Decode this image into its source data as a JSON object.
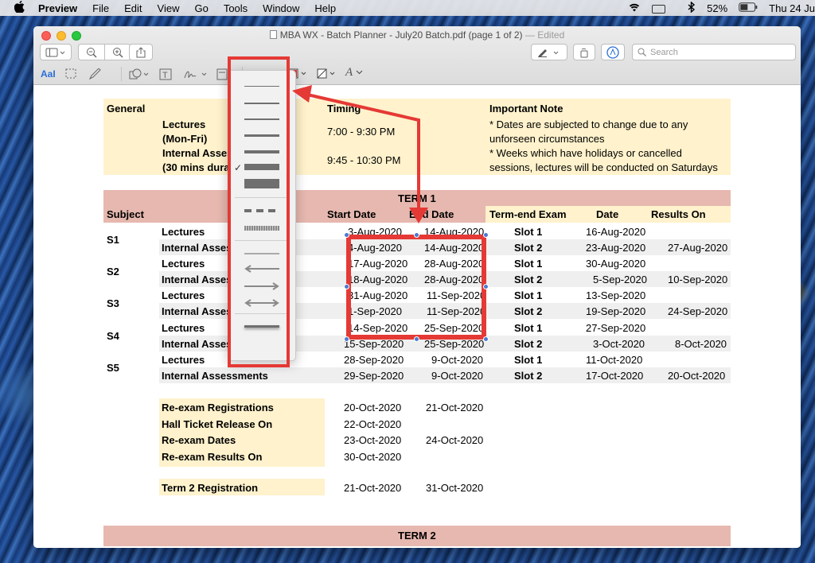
{
  "menubar": {
    "apple": "",
    "app": "Preview",
    "items": [
      "File",
      "Edit",
      "View",
      "Go",
      "Tools",
      "Window",
      "Help"
    ],
    "battery": "52%",
    "clock": "Thu 24 Ju"
  },
  "window": {
    "title": "MBA WX - Batch Planner - July20 Batch.pdf (page 1 of 2)",
    "edited": "— Edited",
    "search_placeholder": "Search"
  },
  "markup_toolbar": {
    "text_style": "AaI",
    "font_tool": "A"
  },
  "doc": {
    "general": {
      "label": "General",
      "lectures": "Lectures",
      "mon_fri": "(Mon-Fri)",
      "internal": "Internal Assess",
      "duration": "(30 mins dura",
      "timing_label": "Timing",
      "time1": "7:00 - 9:30 PM",
      "time2": "9:45 - 10:30 PM",
      "note_label": "Important Note",
      "note1": "* Dates are subjected to change due to any",
      "note2": "unforseen circumstances",
      "note3": "* Weeks which have holidays or cancelled",
      "note4": "sessions, lectures will be conducted on Saturdays"
    },
    "term1": {
      "title": "TERM 1",
      "hdr_subject": "Subject",
      "hdr_start": "Start Date",
      "hdr_end": "End Date",
      "hdr_exam": "Term-end Exam",
      "hdr_date": "Date",
      "hdr_results": "Results On",
      "subjects": [
        "S1",
        "S2",
        "S3",
        "S4",
        "S5"
      ],
      "rows": [
        {
          "type": "Lectures",
          "start": "3-Aug-2020",
          "end": "14-Aug-2020",
          "slot": "Slot 1",
          "date": "16-Aug-2020",
          "results": ""
        },
        {
          "type": "Internal Asses",
          "start": "4-Aug-2020",
          "end": "14-Aug-2020",
          "slot": "Slot 2",
          "date": "23-Aug-2020",
          "results": "27-Aug-2020"
        },
        {
          "type": "Lectures",
          "start": "17-Aug-2020",
          "end": "28-Aug-2020",
          "slot": "Slot 1",
          "date": "30-Aug-2020",
          "results": ""
        },
        {
          "type": "Internal Asses",
          "start": "18-Aug-2020",
          "end": "28-Aug-2020",
          "slot": "Slot 2",
          "date": "5-Sep-2020",
          "results": "10-Sep-2020"
        },
        {
          "type": "Lectures",
          "start": "31-Aug-2020",
          "end": "11-Sep-2020",
          "slot": "Slot 1",
          "date": "13-Sep-2020",
          "results": ""
        },
        {
          "type": "Internal Asses",
          "start": "1-Sep-2020",
          "end": "11-Sep-2020",
          "slot": "Slot 2",
          "date": "19-Sep-2020",
          "results": "24-Sep-2020"
        },
        {
          "type": "Lectures",
          "start": "14-Sep-2020",
          "end": "25-Sep-2020",
          "slot": "Slot 1",
          "date": "27-Sep-2020",
          "results": ""
        },
        {
          "type": "Internal Asses",
          "start": "15-Sep-2020",
          "end": "25-Sep-2020",
          "slot": "Slot 2",
          "date": "3-Oct-2020",
          "results": "8-Oct-2020"
        },
        {
          "type": "Lectures",
          "start": "28-Sep-2020",
          "end": "9-Oct-2020",
          "slot": "Slot 1",
          "date": "11-Oct-2020",
          "results": ""
        },
        {
          "type": "Internal Assessments",
          "start": "29-Sep-2020",
          "end": "9-Oct-2020",
          "slot": "Slot 2",
          "date": "17-Oct-2020",
          "results": "20-Oct-2020"
        }
      ]
    },
    "reexam": [
      {
        "label": "Re-exam Registrations",
        "d1": "20-Oct-2020",
        "d2": "21-Oct-2020"
      },
      {
        "label": "Hall Ticket Release On",
        "d1": "22-Oct-2020",
        "d2": ""
      },
      {
        "label": "Re-exam Dates",
        "d1": "23-Oct-2020",
        "d2": "24-Oct-2020"
      },
      {
        "label": "Re-exam Results On",
        "d1": "30-Oct-2020",
        "d2": ""
      }
    ],
    "term2_reg": {
      "label": "Term 2 Registration",
      "d1": "21-Oct-2020",
      "d2": "31-Oct-2020"
    },
    "term2": {
      "title": "TERM 2"
    }
  },
  "popover": {
    "selected_check": "✓"
  },
  "colors": {
    "header_yellow": "#fff2cc",
    "term_red": "#e6b8af",
    "row_gray": "#efefef",
    "annotation_red": "#e53935",
    "handle_blue": "#4c7ad1"
  }
}
